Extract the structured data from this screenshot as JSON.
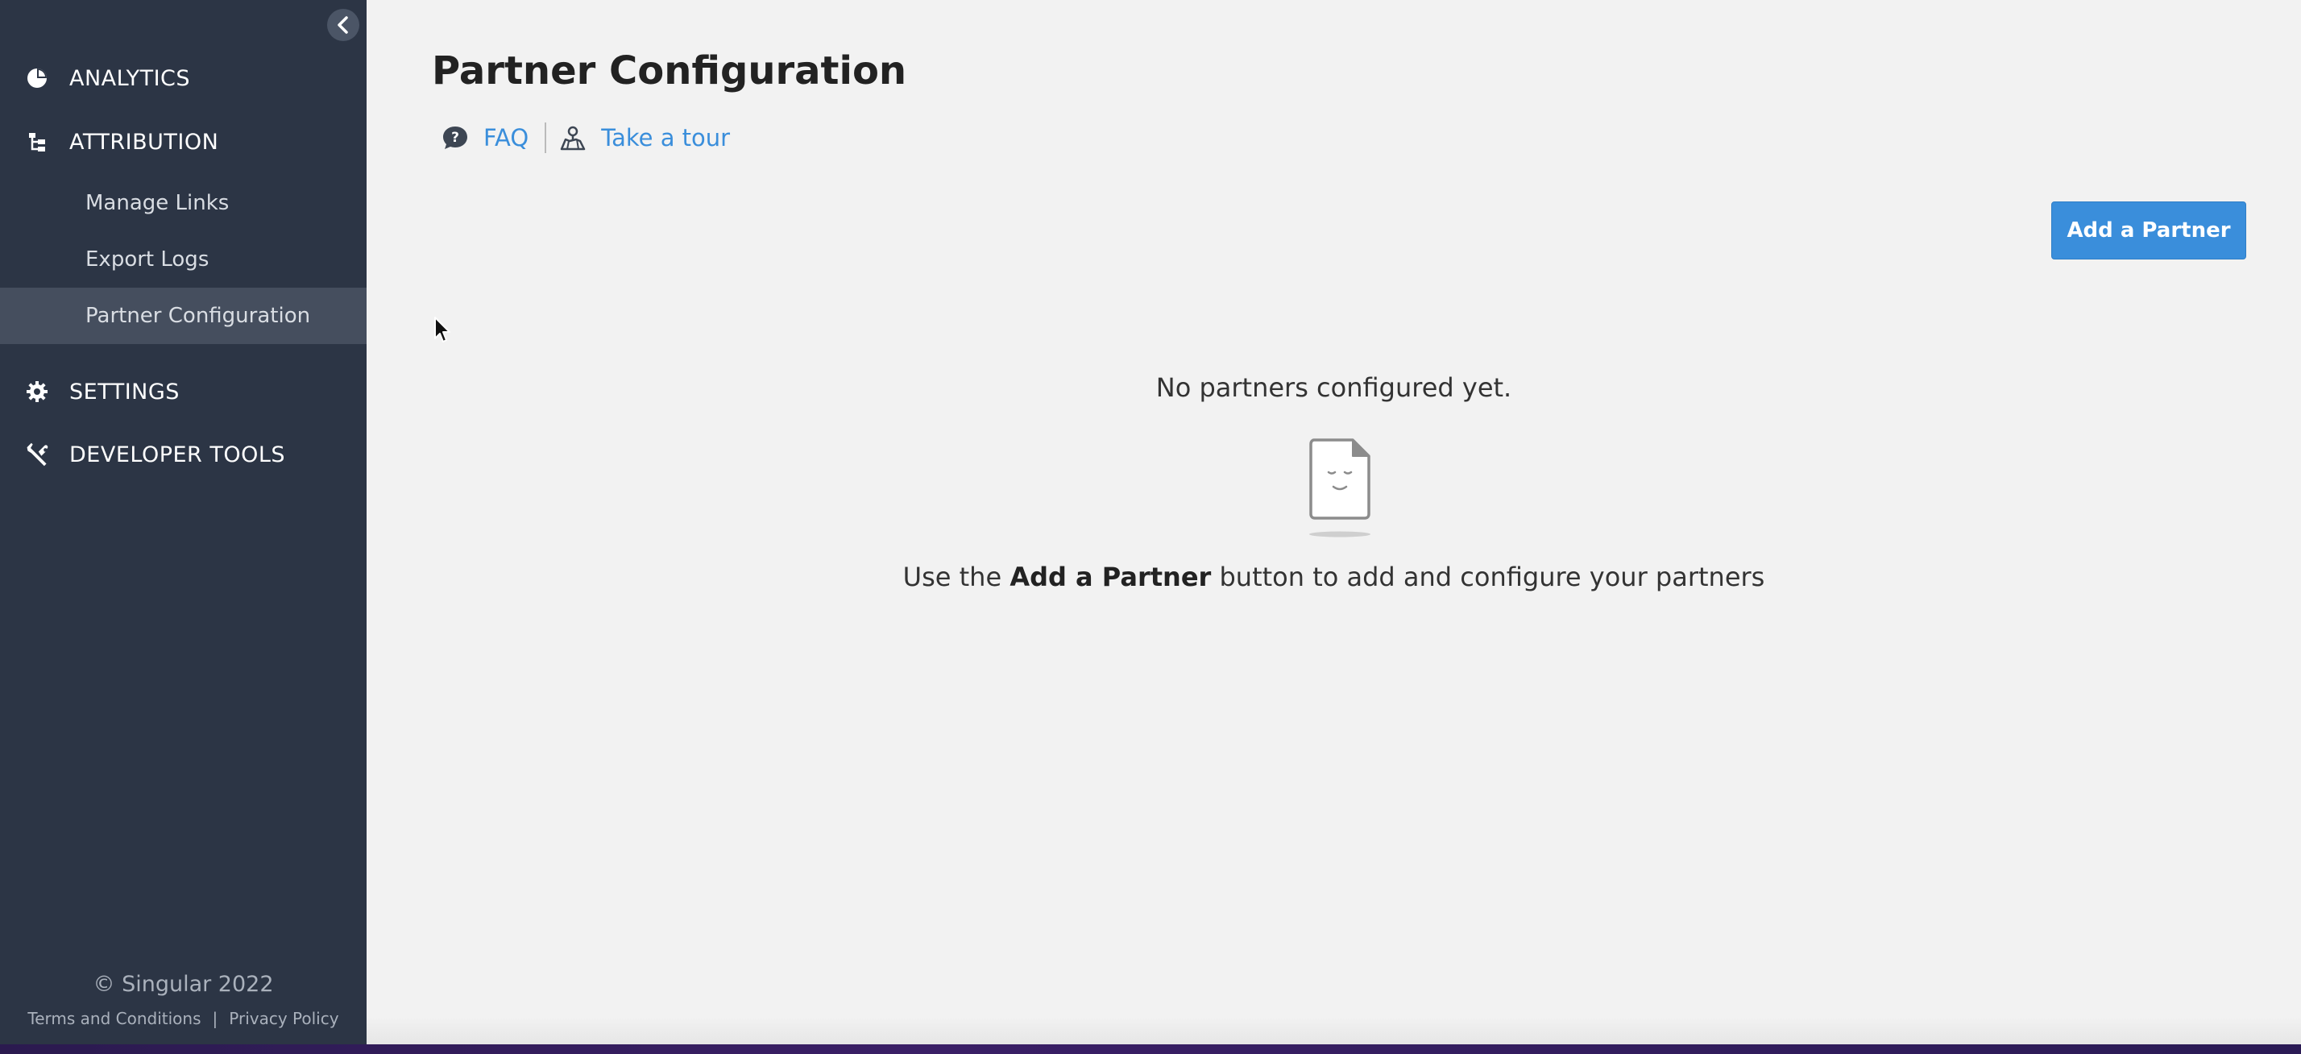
{
  "sidebar": {
    "sections": [
      {
        "label": "ANALYTICS",
        "icon": "pie-chart-icon"
      },
      {
        "label": "ATTRIBUTION",
        "icon": "hierarchy-icon"
      },
      {
        "label": "SETTINGS",
        "icon": "gear-icon"
      },
      {
        "label": "DEVELOPER TOOLS",
        "icon": "wrench-icon"
      }
    ],
    "attribution_items": [
      {
        "label": "Manage Links"
      },
      {
        "label": "Export Logs"
      },
      {
        "label": "Partner Configuration",
        "active": true
      }
    ],
    "footer": {
      "copyright": "© Singular 2022",
      "terms": "Terms and Conditions",
      "separator": "|",
      "privacy": "Privacy Policy"
    },
    "collapse_icon": "chevron-left-icon"
  },
  "main": {
    "title": "Partner Configuration",
    "help_links": {
      "faq": "FAQ",
      "tour": "Take a tour"
    },
    "add_button": "Add a Partner",
    "empty_state": {
      "title": "No partners configured yet.",
      "hint_prefix": "Use the ",
      "hint_bold": "Add a Partner",
      "hint_suffix": " button to add and configure your partners"
    }
  },
  "colors": {
    "sidebar_bg": "#2c3545",
    "sidebar_active": "#454e5e",
    "accent": "#3a8edb",
    "main_bg": "#f2f2f2"
  }
}
